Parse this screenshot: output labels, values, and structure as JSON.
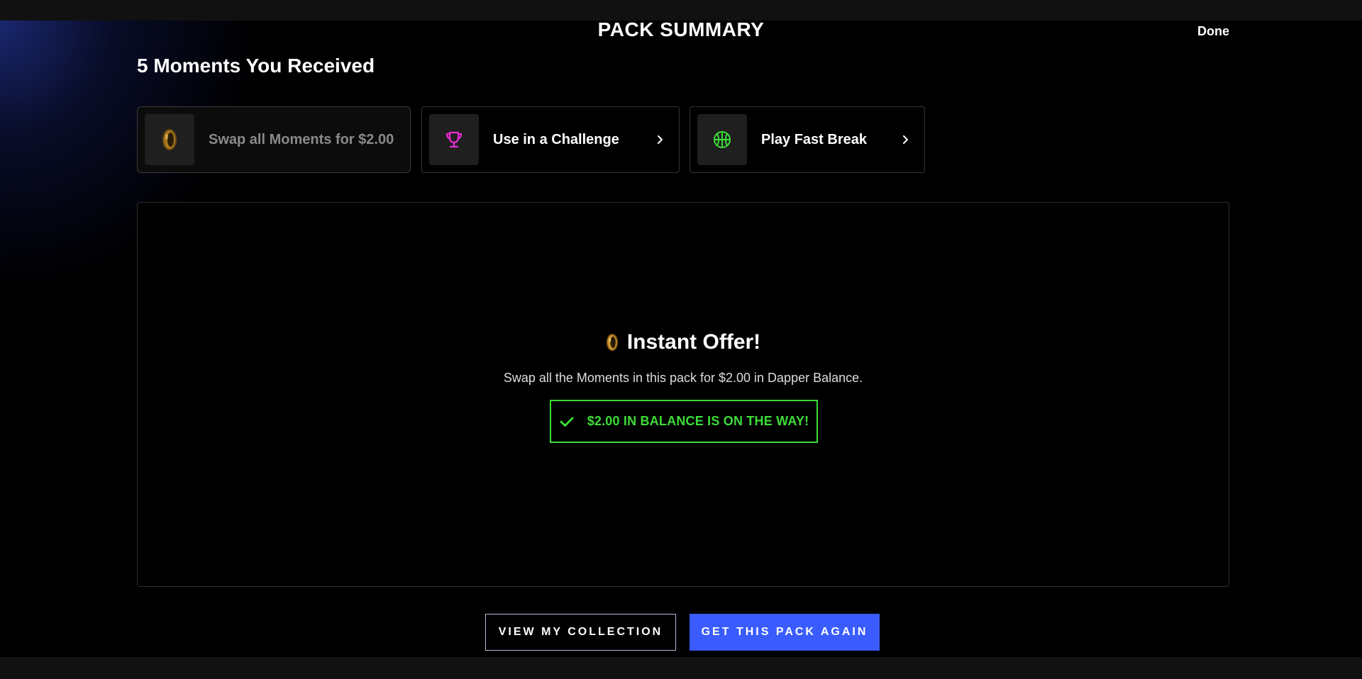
{
  "header": {
    "title": "PACK SUMMARY",
    "done_label": "Done"
  },
  "section": {
    "heading": "5 Moments You Received"
  },
  "actions": [
    {
      "label": "Swap all Moments for $2.00",
      "icon": "coin-icon"
    },
    {
      "label": "Use in a Challenge",
      "icon": "trophy-icon"
    },
    {
      "label": "Play Fast Break",
      "icon": "basketball-icon"
    }
  ],
  "offer": {
    "title": "Instant Offer!",
    "description": "Swap all the Moments in this pack for $2.00 in Dapper Balance.",
    "status": "$2.00 IN BALANCE IS ON THE WAY!"
  },
  "footer": {
    "view_collection_label": "VIEW MY COLLECTION",
    "get_pack_label": "GET THIS PACK AGAIN"
  },
  "colors": {
    "accent_blue": "#3a5cff",
    "success_green": "#3ddc38",
    "trophy_pink": "#e92ad6",
    "coin_gold": "#c8912c"
  }
}
